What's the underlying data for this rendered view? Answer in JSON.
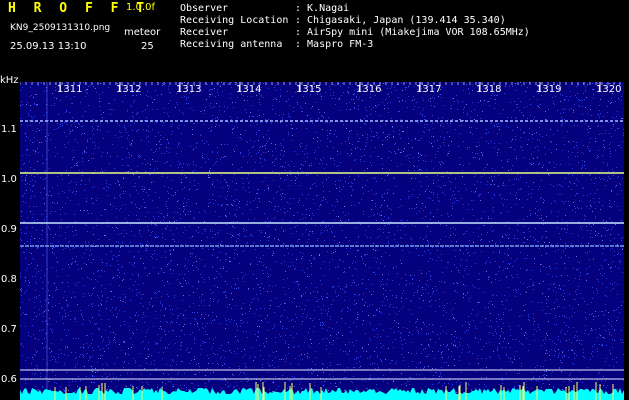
{
  "header": {
    "app_title": "H R O F F T",
    "version": "1.0.0f",
    "filename": "KN9_2509131310.png",
    "datetime": "25.09.13 13:10",
    "meteor_label": "meteor",
    "meteor_count": "25"
  },
  "info": [
    {
      "label": "Observer",
      "value": ": K.Nagai"
    },
    {
      "label": "Receiving Location",
      "value": ": Chigasaki, Japan (139.414 35.340)"
    },
    {
      "label": "Receiver",
      "value": ": AirSpy mini (Miakejima VOR 108.65MHz)"
    },
    {
      "label": "Receiving antenna",
      "value": ": Maspro FM-3"
    }
  ],
  "axis": {
    "y_unit": "kHz",
    "y_ticks": [
      "1.1",
      "1.0",
      "0.9",
      "0.8",
      "0.7",
      "0.6"
    ],
    "x_ticks": [
      "1311",
      "1312",
      "1313",
      "1314",
      "1315",
      "1316",
      "1317",
      "1318",
      "1319",
      "1320"
    ]
  },
  "colors": {
    "background": "#04007e",
    "noise": "#2a4cff",
    "carrier": "#e8ff8a",
    "bottom_band": "#00ffff",
    "text_yellow": "#ffff00"
  }
}
